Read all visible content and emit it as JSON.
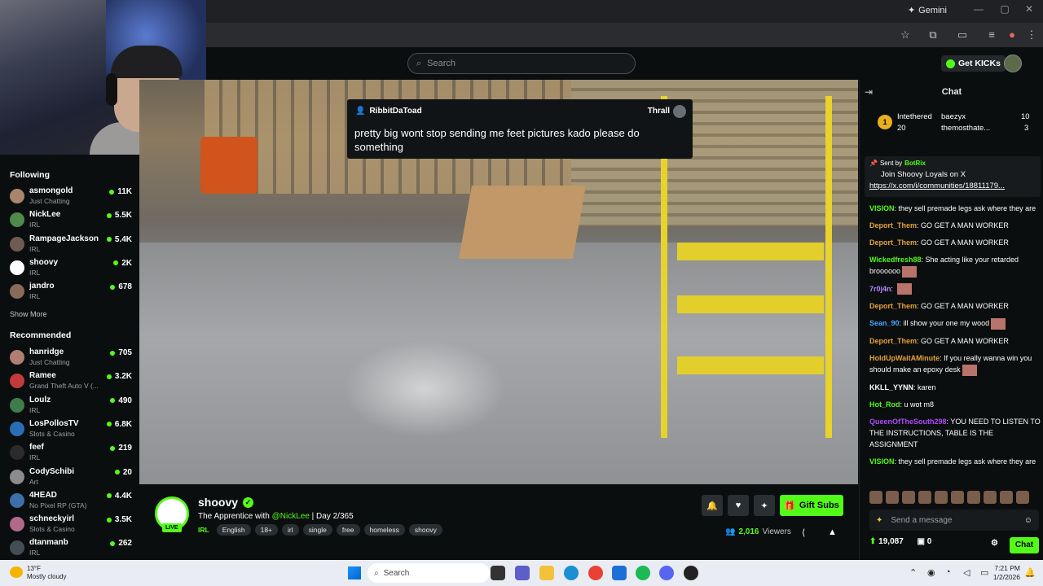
{
  "browser": {
    "gemini_label": "Gemini",
    "icons": [
      "star-icon",
      "extensions-icon",
      "sidepanel-icon",
      "media-icon",
      "profile-icon",
      "menu-icon"
    ]
  },
  "header": {
    "search_placeholder": "Search",
    "get_kicks_label": "Get KICKs"
  },
  "sidebar": {
    "following_title": "Following",
    "following": [
      {
        "name": "asmongold",
        "category": "Just Chatting",
        "viewers": "11K",
        "avatar_color": "#a9856b"
      },
      {
        "name": "NickLee",
        "category": "IRL",
        "viewers": "5.5K",
        "avatar_color": "#4f8a4a"
      },
      {
        "name": "RampageJackson",
        "category": "IRL",
        "viewers": "5.4K",
        "avatar_color": "#6e5b52"
      },
      {
        "name": "shoovy",
        "category": "IRL",
        "viewers": "2K",
        "avatar_color": "#ffffff"
      },
      {
        "name": "jandro",
        "category": "IRL",
        "viewers": "678",
        "avatar_color": "#8a6b5a"
      }
    ],
    "show_more": "Show More",
    "recommended_title": "Recommended",
    "recommended": [
      {
        "name": "hanridge",
        "category": "Just Chatting",
        "viewers": "705",
        "avatar_color": "#b07f72"
      },
      {
        "name": "Ramee",
        "category": "Grand Theft Auto V (...",
        "viewers": "3.2K",
        "avatar_color": "#c23b3b"
      },
      {
        "name": "Loulz",
        "category": "IRL",
        "viewers": "490",
        "avatar_color": "#3e7d4b"
      },
      {
        "name": "LosPollosTV",
        "category": "Slots & Casino",
        "viewers": "6.8K",
        "avatar_color": "#2a6db5"
      },
      {
        "name": "feef",
        "category": "IRL",
        "viewers": "219",
        "avatar_color": "#2b2b2b"
      },
      {
        "name": "CodySchibi",
        "category": "Art",
        "viewers": "20",
        "avatar_color": "#8c8c8c"
      },
      {
        "name": "4HEAD",
        "category": "No Pixel RP (GTA)",
        "viewers": "4.4K",
        "avatar_color": "#3d6fa8"
      },
      {
        "name": "schneckyirl",
        "category": "Slots & Casino",
        "viewers": "3.5K",
        "avatar_color": "#b06a88"
      },
      {
        "name": "dtanmanb",
        "category": "IRL",
        "viewers": "262",
        "avatar_color": "#444c55"
      }
    ]
  },
  "pinned_message": {
    "author": "RibbitDaToad",
    "pinned_by": "Thrall",
    "text": "pretty big wont stop sending me feet pictures kado please do something"
  },
  "stream": {
    "channel": "shoovy",
    "live_label": "LIVE",
    "title_prefix": "The Apprentice with",
    "title_mention": "@NickLee",
    "title_suffix": "| Day 2/365",
    "category": "IRL",
    "tags": [
      "English",
      "18+",
      "irl",
      "single",
      "free",
      "homeless",
      "shoovy"
    ],
    "gift_subs_label": "Gift Subs",
    "viewer_count": "2,016",
    "viewers_label": "Viewers"
  },
  "chat": {
    "title": "Chat",
    "leaderboard": [
      {
        "rank": "1",
        "name": "Intethered",
        "value": "20"
      },
      {
        "name": "baezyx",
        "value": "10"
      },
      {
        "name": "themosthate...",
        "value": "3"
      }
    ],
    "pinned": {
      "sent_by_label": "Sent by",
      "bot_name": "BotRix",
      "line1": "Join Shoovy Loyals on X",
      "link": "https://x.com/i/communities/18811179..."
    },
    "messages": [
      {
        "user": "VISION",
        "color": "#53fc18",
        "text": "they sell premade legs ask where they are"
      },
      {
        "user": "Deport_Them",
        "color": "#e6a23c",
        "text": "GO GET A MAN WORKER"
      },
      {
        "user": "Deport_Them",
        "color": "#e6a23c",
        "text": "GO GET A MAN WORKER"
      },
      {
        "user": "Wickedfresh88",
        "color": "#53fc18",
        "text": "She acting like your retarded broooooo"
      },
      {
        "user": "7r0j4n",
        "color": "#b388ff",
        "text": ""
      },
      {
        "user": "Deport_Them",
        "color": "#e6a23c",
        "text": "GO GET A MAN WORKER"
      },
      {
        "user": "Sean_90",
        "color": "#4aa3ff",
        "text": "ill show your one my wood"
      },
      {
        "user": "Deport_Them",
        "color": "#e6a23c",
        "text": "GO GET A MAN WORKER"
      },
      {
        "user": "HoldUpWaitAMinute",
        "color": "#e6a23c",
        "text": "If you really wanna win you should make an epoxy desk"
      },
      {
        "user": "KKLL_YYNN",
        "color": "#ffffff",
        "text": "karen"
      },
      {
        "user": "Hot_Rod",
        "color": "#53fc18",
        "text": "u wot m8"
      },
      {
        "user": "QueenOfTheSouth298",
        "color": "#b04aff",
        "text": "YOU NEED TO LISTEN TO THE INSTRUCTIONS, TABLE IS THE ASSIGNMENT"
      },
      {
        "user": "VISION",
        "color": "#53fc18",
        "text": "they sell premade legs ask where they are"
      }
    ],
    "send_placeholder": "Send a message",
    "kicks_balance": "19,087",
    "points": "0",
    "chat_button": "Chat"
  },
  "taskbar": {
    "temperature": "13°F",
    "weather": "Mostly cloudy",
    "search_label": "Search",
    "time": "7:21 PM",
    "date": "1/2/2026"
  }
}
